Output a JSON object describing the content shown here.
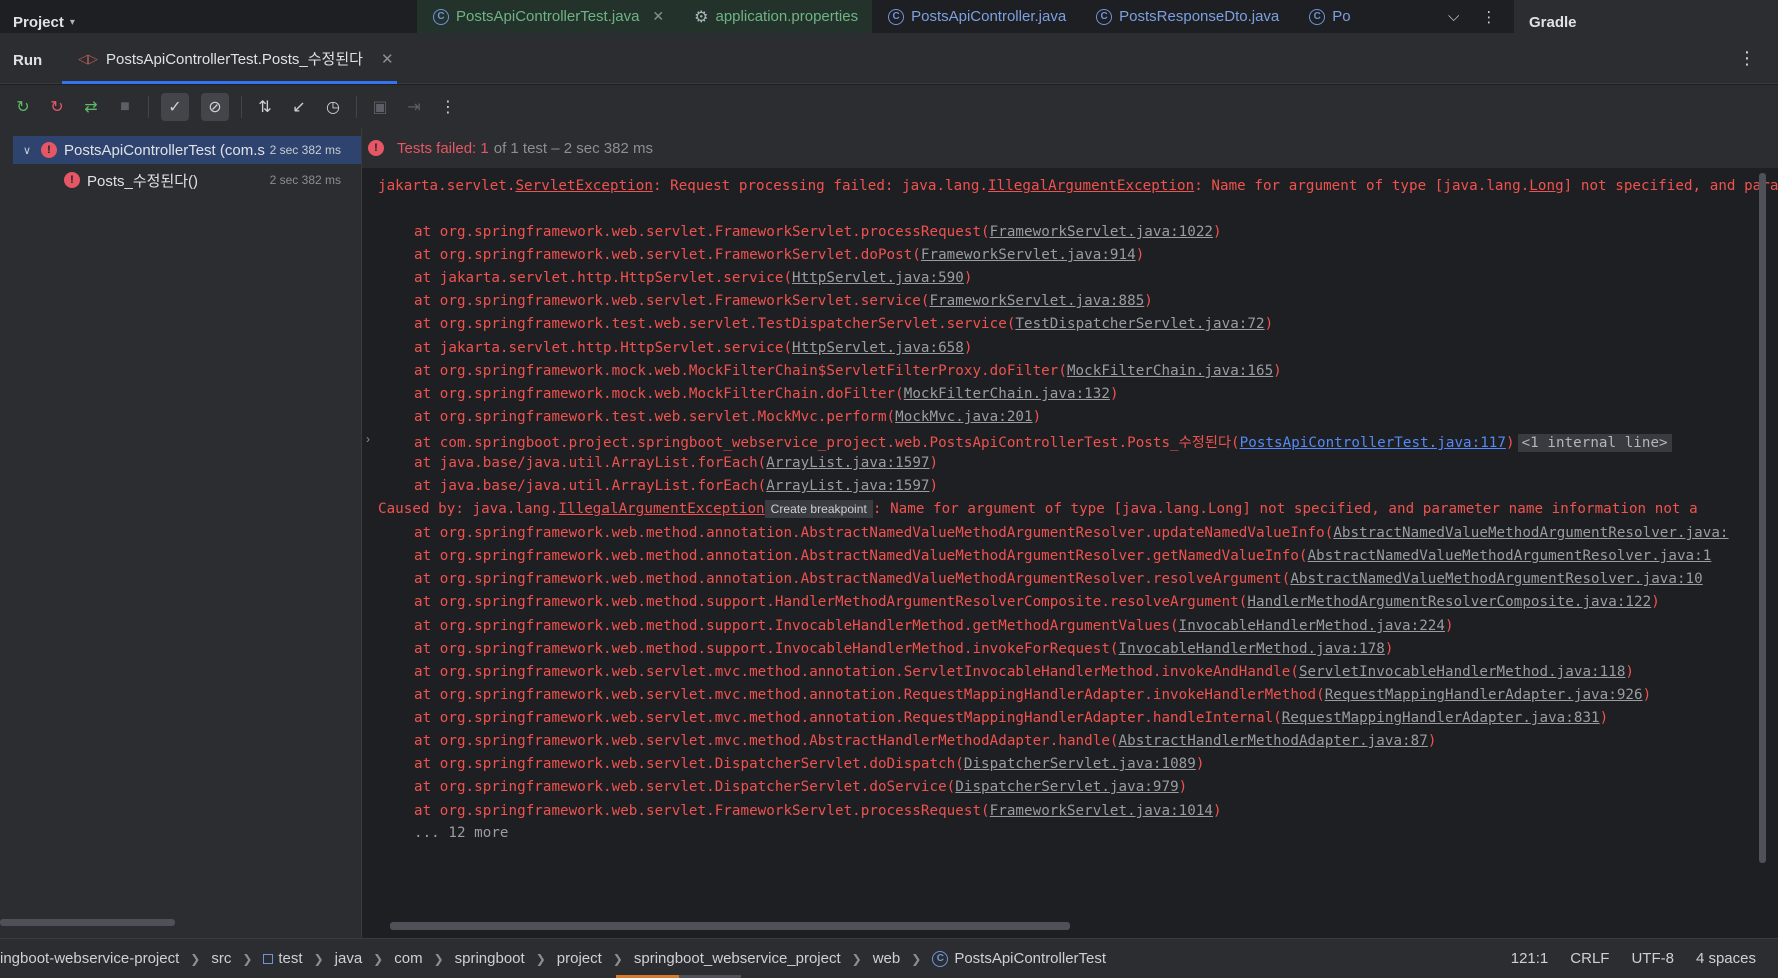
{
  "topbar": {
    "project_label": "Project",
    "tabs": [
      {
        "label": "PostsApiControllerTest.java"
      },
      {
        "label": "application.properties"
      },
      {
        "label": "PostsApiController.java"
      },
      {
        "label": "PostsResponseDto.java"
      },
      {
        "label": "Po"
      }
    ],
    "gradle_label": "Gradle"
  },
  "run": {
    "label": "Run",
    "tab_label": "PostsApiControllerTest.Posts_수정된다"
  },
  "tree": {
    "root": {
      "name": "PostsApiControllerTest (com.s",
      "time": "2 sec 382 ms"
    },
    "child": {
      "name": "Posts_수정된다()",
      "time": "2 sec 382 ms"
    }
  },
  "status": {
    "failed_label": "Tests failed:",
    "failed_count": "1",
    "rest": "of 1 test – 2 sec 382 ms"
  },
  "log": {
    "l0": {
      "pre": "jakarta.servlet.",
      "u1": "ServletException",
      "mid": ": Request processing failed: java.lang.",
      "u2": "IllegalArgumentException",
      "mid2": ": Name for argument of type [java.lang.",
      "u3": "Long",
      "post": "] not specified, and parameter name information not a"
    },
    "l1": {
      "code": "at org.springframework.web.servlet.FrameworkServlet.processRequest(",
      "link": "FrameworkServlet.java:1022",
      "end": ")"
    },
    "l2": {
      "code": "at org.springframework.web.servlet.FrameworkServlet.doPost(",
      "link": "FrameworkServlet.java:914",
      "end": ")"
    },
    "l3": {
      "code": "at jakarta.servlet.http.HttpServlet.service(",
      "link": "HttpServlet.java:590",
      "end": ")"
    },
    "l4": {
      "code": "at org.springframework.web.servlet.FrameworkServlet.service(",
      "link": "FrameworkServlet.java:885",
      "end": ")"
    },
    "l5": {
      "code": "at org.springframework.test.web.servlet.TestDispatcherServlet.service(",
      "link": "TestDispatcherServlet.java:72",
      "end": ")"
    },
    "l6": {
      "code": "at jakarta.servlet.http.HttpServlet.service(",
      "link": "HttpServlet.java:658",
      "end": ")"
    },
    "l7": {
      "code": "at org.springframework.mock.web.MockFilterChain$ServletFilterProxy.doFilter(",
      "link": "MockFilterChain.java:165",
      "end": ")"
    },
    "l8": {
      "code": "at org.springframework.mock.web.MockFilterChain.doFilter(",
      "link": "MockFilterChain.java:132",
      "end": ")"
    },
    "l9": {
      "code": "at org.springframework.test.web.servlet.MockMvc.perform(",
      "link": "MockMvc.java:201",
      "end": ")"
    },
    "l10": {
      "code": "at com.springboot.project.springboot_webservice_project.web.PostsApiControllerTest.Posts_수정된다(",
      "link": "PostsApiControllerTest.java:117",
      "end": ")",
      "internal": "<1 internal line>"
    },
    "l11": {
      "code": "at java.base/java.util.ArrayList.forEach(",
      "link": "ArrayList.java:1597",
      "end": ")"
    },
    "l12": {
      "code": "at java.base/java.util.ArrayList.forEach(",
      "link": "ArrayList.java:1597",
      "end": ")"
    },
    "l13": {
      "pre": "Caused by: java.lang.",
      "u1": "IllegalArgumentException",
      "tip": "Create breakpoint",
      "post": ": Name for argument of type [java.lang.Long] not specified, and parameter name information not a"
    },
    "l14": {
      "code": "at org.springframework.web.method.annotation.AbstractNamedValueMethodArgumentResolver.updateNamedValueInfo(",
      "link": "AbstractNamedValueMethodArgumentResolver.java:"
    },
    "l15": {
      "code": "at org.springframework.web.method.annotation.AbstractNamedValueMethodArgumentResolver.getNamedValueInfo(",
      "link": "AbstractNamedValueMethodArgumentResolver.java:1"
    },
    "l16": {
      "code": "at org.springframework.web.method.annotation.AbstractNamedValueMethodArgumentResolver.resolveArgument(",
      "link": "AbstractNamedValueMethodArgumentResolver.java:10"
    },
    "l17": {
      "code": "at org.springframework.web.method.support.HandlerMethodArgumentResolverComposite.resolveArgument(",
      "link": "HandlerMethodArgumentResolverComposite.java:122",
      "end": ")"
    },
    "l18": {
      "code": "at org.springframework.web.method.support.InvocableHandlerMethod.getMethodArgumentValues(",
      "link": "InvocableHandlerMethod.java:224",
      "end": ")"
    },
    "l19": {
      "code": "at org.springframework.web.method.support.InvocableHandlerMethod.invokeForRequest(",
      "link": "InvocableHandlerMethod.java:178",
      "end": ")"
    },
    "l20": {
      "code": "at org.springframework.web.servlet.mvc.method.annotation.ServletInvocableHandlerMethod.invokeAndHandle(",
      "link": "ServletInvocableHandlerMethod.java:118",
      "end": ")"
    },
    "l21": {
      "code": "at org.springframework.web.servlet.mvc.method.annotation.RequestMappingHandlerAdapter.invokeHandlerMethod(",
      "link": "RequestMappingHandlerAdapter.java:926",
      "end": ")"
    },
    "l22": {
      "code": "at org.springframework.web.servlet.mvc.method.annotation.RequestMappingHandlerAdapter.handleInternal(",
      "link": "RequestMappingHandlerAdapter.java:831",
      "end": ")"
    },
    "l23": {
      "code": "at org.springframework.web.servlet.mvc.method.AbstractHandlerMethodAdapter.handle(",
      "link": "AbstractHandlerMethodAdapter.java:87",
      "end": ")"
    },
    "l24": {
      "code": "at org.springframework.web.servlet.DispatcherServlet.doDispatch(",
      "link": "DispatcherServlet.java:1089",
      "end": ")"
    },
    "l25": {
      "code": "at org.springframework.web.servlet.DispatcherServlet.doService(",
      "link": "DispatcherServlet.java:979",
      "end": ")"
    },
    "l26": {
      "code": "at org.springframework.web.servlet.FrameworkServlet.processRequest(",
      "link": "FrameworkServlet.java:1014",
      "end": ")"
    },
    "l27": {
      "more": "... 12 more"
    }
  },
  "breadcrumb": {
    "items": [
      "ingboot-webservice-project",
      "src",
      "test",
      "java",
      "com",
      "springboot",
      "project",
      "springboot_webservice_project",
      "web",
      "PostsApiControllerTest"
    ]
  },
  "statusbar": {
    "position": "121:1",
    "line_sep": "CRLF",
    "encoding": "UTF-8",
    "indent": "4 spaces",
    "progress": 0.5
  },
  "colors": {
    "error": "#f0524f",
    "accent": "#3574f0",
    "selection": "#2e436e",
    "link": "#548af7"
  },
  "icons": [
    "rerun-icon",
    "rerun-failed-icon",
    "toggle-auto-test-icon",
    "stop-icon",
    "show-passed-icon",
    "show-ignored-icon",
    "sort-icon",
    "collapse-icon",
    "history-icon",
    "camera-icon",
    "import-icon",
    "more-icon"
  ]
}
